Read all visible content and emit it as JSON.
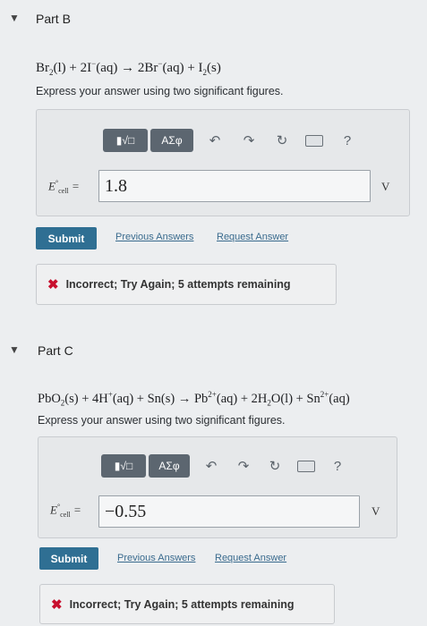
{
  "partB": {
    "toggle_icon": "caret-down-icon",
    "title": "Part B",
    "instruction": "Express your answer using two significant figures.",
    "toolbar": {
      "template_icon": "template-sqrt-icon",
      "greek_label": "ΑΣφ",
      "undo_icon": "undo-icon",
      "redo_icon": "redo-icon",
      "reset_icon": "reset-icon",
      "keyboard_icon": "keyboard-icon",
      "help_label": "?"
    },
    "answer_value": "1.8",
    "unit": "V",
    "submit_label": "Submit",
    "previous_answers_label": "Previous Answers",
    "request_answer_label": "Request Answer",
    "feedback": "Incorrect; Try Again; 5 attempts remaining"
  },
  "partC": {
    "toggle_icon": "caret-down-icon",
    "title": "Part C",
    "instruction": "Express your answer using two significant figures.",
    "toolbar": {
      "template_icon": "template-sqrt-icon",
      "greek_label": "ΑΣφ",
      "undo_icon": "undo-icon",
      "redo_icon": "redo-icon",
      "reset_icon": "reset-icon",
      "keyboard_icon": "keyboard-icon",
      "help_label": "?"
    },
    "answer_value": "−0.55",
    "unit": "V",
    "submit_label": "Submit",
    "previous_answers_label": "Previous Answers",
    "request_answer_label": "Request Answer",
    "feedback": "Incorrect; Try Again; 5 attempts remaining"
  },
  "colors": {
    "submit": "#2f6f93",
    "link": "#3a6b8e",
    "error_x": "#c8102e",
    "toolbar_button": "#5c6670"
  }
}
